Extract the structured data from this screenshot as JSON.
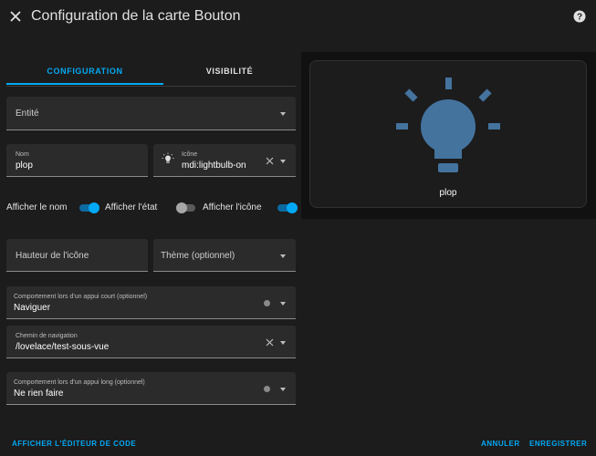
{
  "header": {
    "title": "Configuration de la carte Bouton"
  },
  "tabs": [
    {
      "label": "CONFIGURATION"
    },
    {
      "label": "VISIBILITÉ"
    }
  ],
  "fields": {
    "entity": {
      "label": "Entité"
    },
    "name": {
      "label": "Nom",
      "value": "plop"
    },
    "icon": {
      "label": "Icône",
      "value": "mdi:lightbulb-on"
    },
    "icon_height": {
      "label": "Hauteur de l'icône"
    },
    "theme": {
      "label": "Thème (optionnel)"
    },
    "tap_action": {
      "label": "Comportement lors d'un appui court (optionnel)",
      "value": "Naviguer"
    },
    "navigation_path": {
      "label": "Chemin de navigation",
      "value": "/lovelace/test-sous-vue"
    },
    "hold_action": {
      "label": "Comportement lors d'un appui long (optionnel)",
      "value": "Ne rien faire"
    }
  },
  "toggles": [
    {
      "label": "Afficher le nom",
      "state": "on"
    },
    {
      "label": "Afficher l'état",
      "state": "off"
    },
    {
      "label": "Afficher l'icône",
      "state": "on"
    }
  ],
  "preview": {
    "name": "plop",
    "icon": "lightbulb-on-icon",
    "icon_color": "#44739e"
  },
  "footer": {
    "code_editor": "AFFICHER L'ÉDITEUR DE CODE",
    "cancel": "ANNULER",
    "save": "ENREGISTRER"
  },
  "colors": {
    "accent": "#03a9f4",
    "background": "#1c1c1c",
    "field": "#2b2b2b"
  }
}
